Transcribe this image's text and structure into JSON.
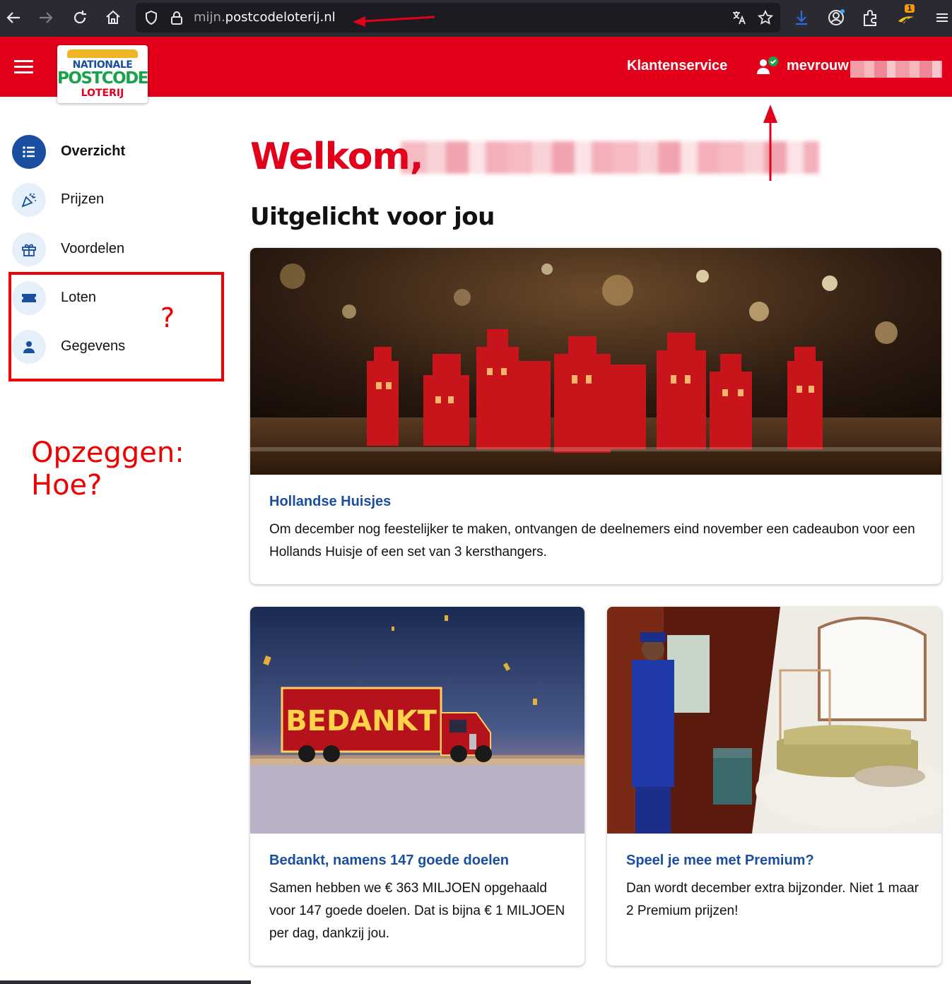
{
  "browser": {
    "url_subdomain": "mijn.",
    "url_domain": "postcodeloterij.nl",
    "extension_badge": "1"
  },
  "header": {
    "logo": {
      "line1": "NATIONALE",
      "line2": "POSTCODE",
      "line3": "LOTERIJ"
    },
    "customer_service": "Klantenservice",
    "user_salutation": "mevrouw"
  },
  "sidebar": {
    "items": [
      {
        "label": "Overzicht",
        "icon": "list-icon"
      },
      {
        "label": "Prijzen",
        "icon": "party-popper-icon"
      },
      {
        "label": "Voordelen",
        "icon": "gift-icon"
      },
      {
        "label": "Loten",
        "icon": "ticket-icon"
      },
      {
        "label": "Gegevens",
        "icon": "person-icon"
      }
    ]
  },
  "annotations": {
    "question_mark": "?",
    "cancel_line1": "Opzeggen:",
    "cancel_line2": "Hoe?"
  },
  "main": {
    "welcome": "Welkom,",
    "featured_heading": "Uitgelicht voor jou",
    "cards": [
      {
        "title": "Hollandse Huisjes",
        "text": "Om december nog feestelijker te maken, ontvangen de deelnemers eind november een cadeaubon voor een Hollands Huisje of een set van 3 kersthangers."
      },
      {
        "title": "Bedankt, namens 147 goede doelen",
        "text": "Samen hebben we € 363 MILJOEN opgehaald voor 147 goede doelen. Dat is bijna € 1 MILJOEN per dag, dankzij jou.",
        "truck_text": "BEDANKT"
      },
      {
        "title": "Speel je mee met Premium?",
        "text": "Dan wordt december extra bijzonder. Niet 1 maar 2 Premium prijzen!"
      }
    ]
  },
  "colors": {
    "brand_red": "#e2001a",
    "brand_blue": "#1a4ea0",
    "brand_green": "#18a24a",
    "annotation_red": "#ee0000"
  }
}
